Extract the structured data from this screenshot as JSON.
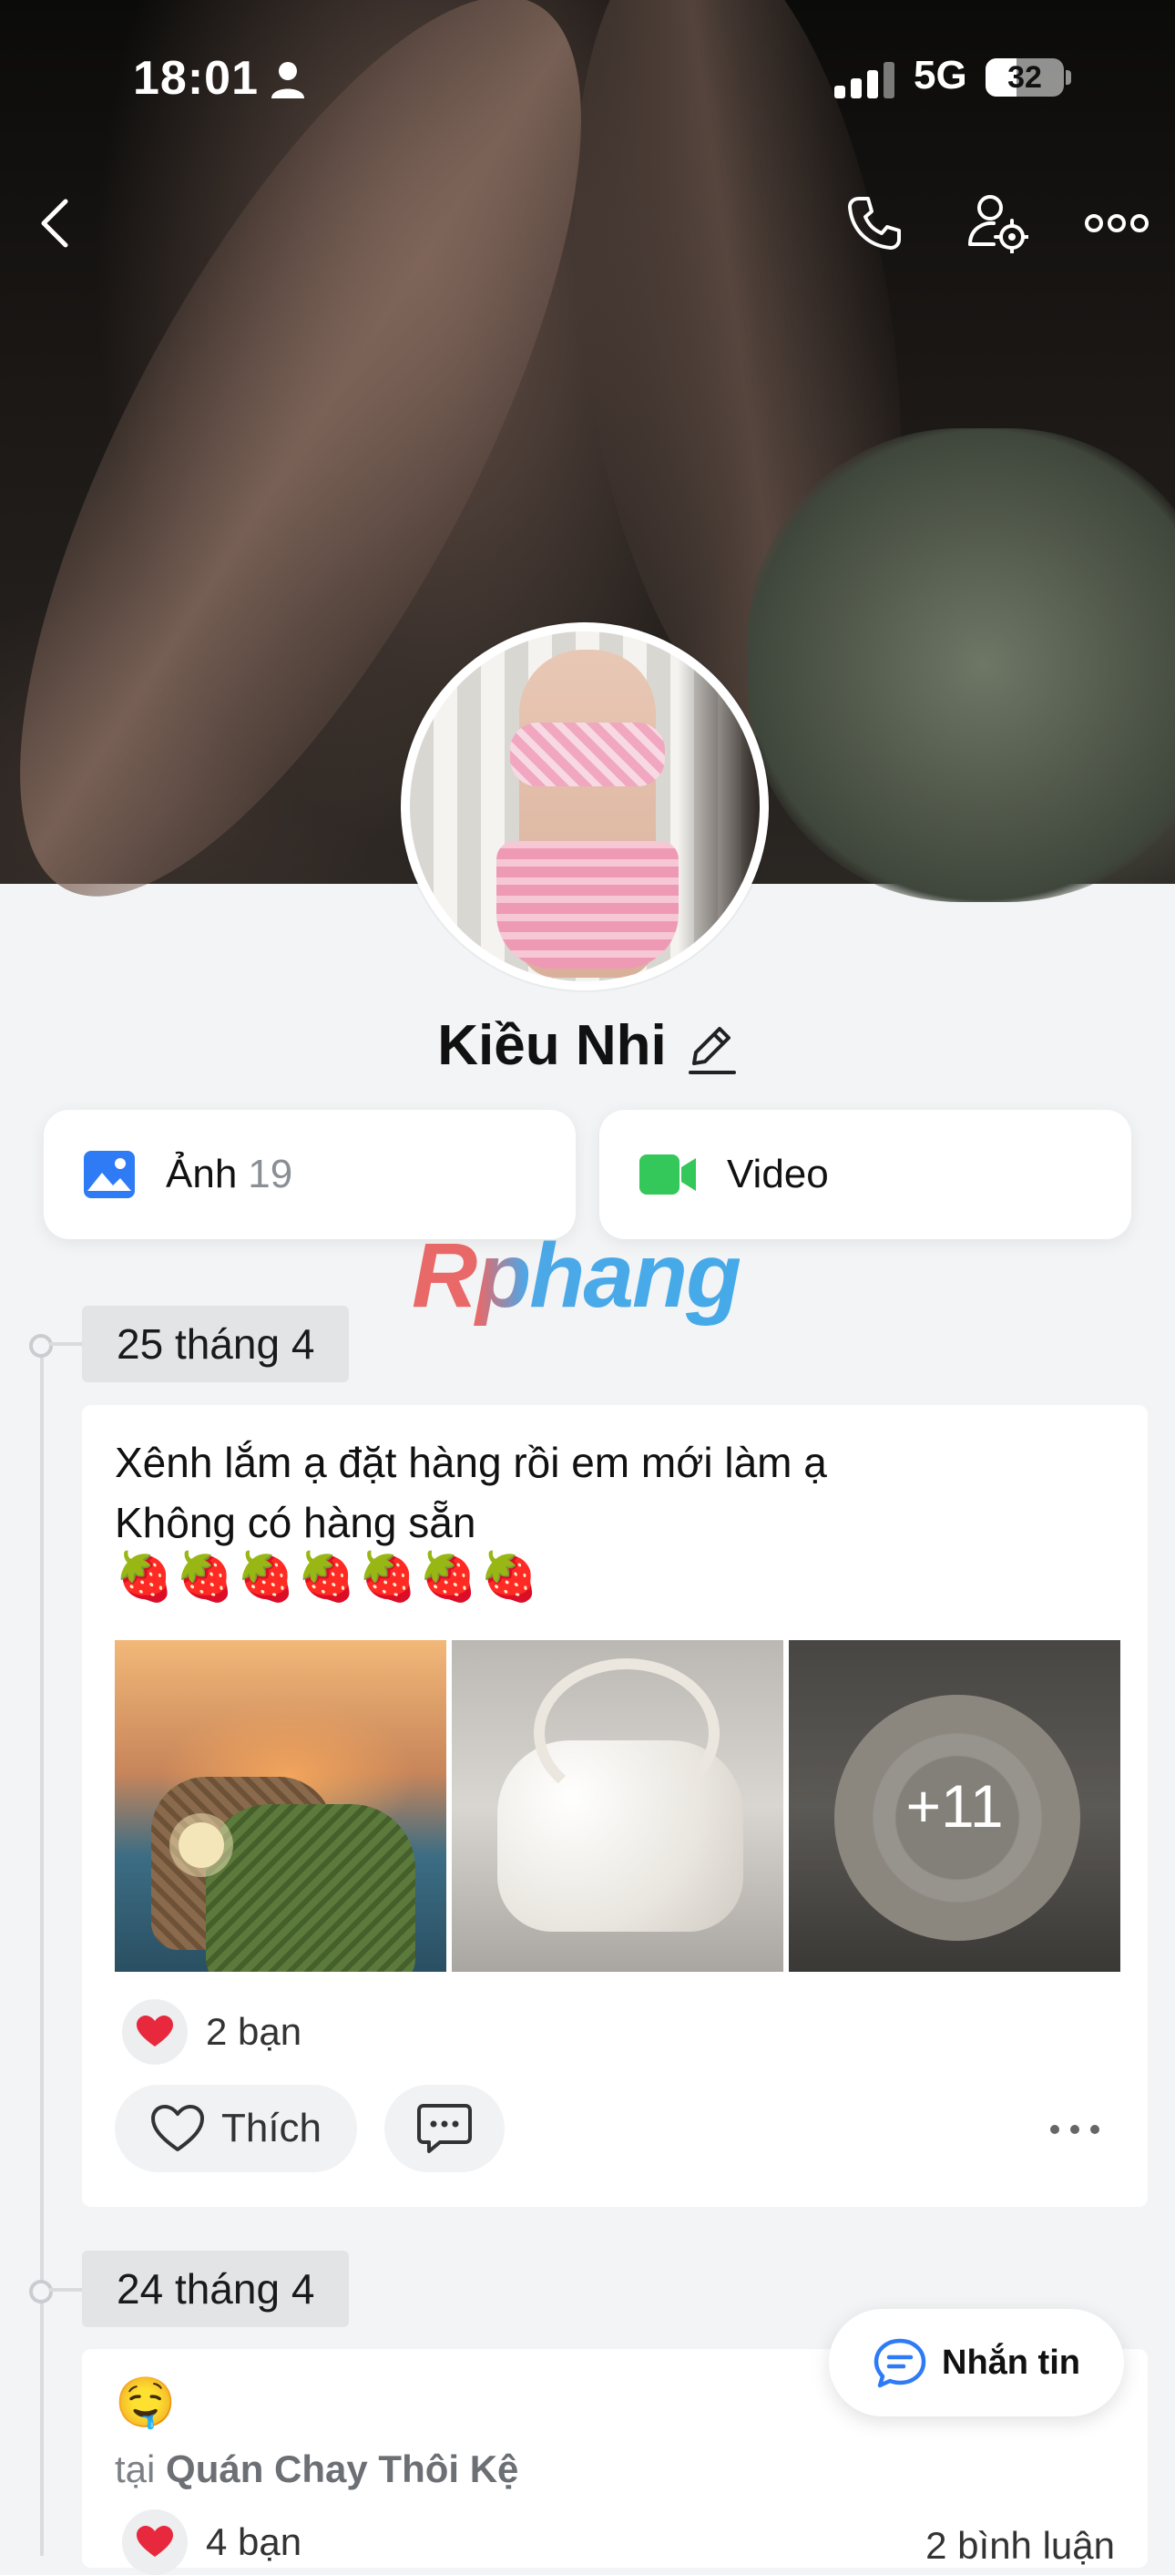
{
  "status_bar": {
    "time": "18:01",
    "network": "5G",
    "battery": "32"
  },
  "profile": {
    "name": "Kiều Nhi"
  },
  "media_tabs": {
    "photos_label": "Ảnh",
    "photos_count": "19",
    "video_label": "Video"
  },
  "watermark": "Rphang",
  "timeline": [
    {
      "date": "25 tháng 4",
      "text_line1": "Xênh lắm ạ đặt hàng rồi em mới làm ạ",
      "text_line2": "Không có hàng sẵn",
      "emoji_line": "🍓🍓🍓🍓🍓🍓🍓",
      "extra_photos": "+11",
      "reactions": "2 bạn",
      "like_label": "Thích"
    },
    {
      "date": "24 tháng 4",
      "emoji": "🤤",
      "location_prefix": "tại",
      "location_name": "Quán Chay Thôi Kệ",
      "reactions": "4 bạn",
      "comments": "2 bình luận"
    }
  ],
  "message_button": {
    "label": "Nhắn tin"
  },
  "colors": {
    "accent_blue": "#2f7bf5",
    "video_green": "#34c759",
    "heart_red": "#e8283c"
  }
}
